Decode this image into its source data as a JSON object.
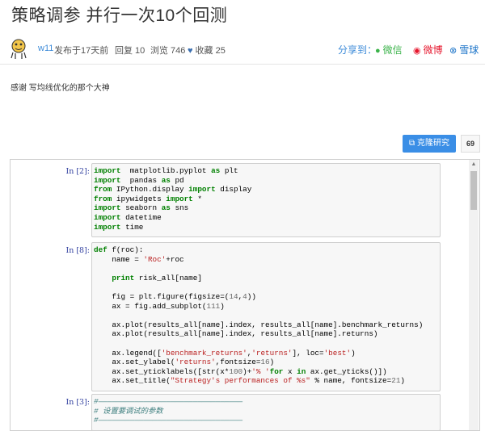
{
  "page": {
    "title": "策略调参 并行一次10个回测"
  },
  "meta": {
    "user": "w11",
    "posted": "发布于17天前",
    "replies": "回复 10",
    "views": "浏览 746",
    "favorites": "收藏 25",
    "heart_icon": "heart-icon"
  },
  "share": {
    "label": "分享到：",
    "wechat": "微信",
    "weibo": "微博",
    "xueqiu": "雪球"
  },
  "post": {
    "body": "感谢 写均线优化的那个大神"
  },
  "actions": {
    "clone_label": "克隆研究",
    "clone_count": "69"
  },
  "notebook": {
    "cells": [
      {
        "prompt": "In [2]:",
        "lines": [
          [
            [
              "kw",
              "import"
            ],
            [
              "",
              "  matplotlib.pyplot "
            ],
            [
              "kw",
              "as"
            ],
            [
              "",
              " plt"
            ]
          ],
          [
            [
              "kw",
              "import"
            ],
            [
              "",
              "  pandas "
            ],
            [
              "kw",
              "as"
            ],
            [
              "",
              " pd"
            ]
          ],
          [
            [
              "kw",
              "from"
            ],
            [
              "",
              " IPython.display "
            ],
            [
              "kw",
              "import"
            ],
            [
              "",
              " display"
            ]
          ],
          [
            [
              "kw",
              "from"
            ],
            [
              "",
              " ipywidgets "
            ],
            [
              "kw",
              "import"
            ],
            [
              "",
              " *"
            ]
          ],
          [
            [
              "kw",
              "import"
            ],
            [
              "",
              " seaborn "
            ],
            [
              "kw",
              "as"
            ],
            [
              "",
              " sns"
            ]
          ],
          [
            [
              "kw",
              "import"
            ],
            [
              "",
              " datetime"
            ]
          ],
          [
            [
              "kw",
              "import"
            ],
            [
              "",
              " time"
            ]
          ]
        ]
      },
      {
        "prompt": "In [8]:",
        "lines": [
          [
            [
              "kw",
              "def"
            ],
            [
              "",
              " f(roc):"
            ]
          ],
          [
            [
              "",
              "    name = "
            ],
            [
              "str",
              "'Roc'"
            ],
            [
              "",
              "+roc"
            ]
          ],
          [
            [
              "",
              ""
            ]
          ],
          [
            [
              "kw",
              "    print"
            ],
            [
              "",
              " risk_all[name]"
            ]
          ],
          [
            [
              "",
              ""
            ]
          ],
          [
            [
              "",
              "    fig = plt.figure(figsize=("
            ],
            [
              "num",
              "14"
            ],
            [
              "",
              ","
            ],
            [
              "num",
              "4"
            ],
            [
              "",
              "))"
            ]
          ],
          [
            [
              "",
              "    ax = fig.add_subplot("
            ],
            [
              "num",
              "111"
            ],
            [
              "",
              ")"
            ]
          ],
          [
            [
              "",
              ""
            ]
          ],
          [
            [
              "",
              "    ax.plot(results_all[name].index, results_all[name].benchmark_returns)"
            ]
          ],
          [
            [
              "",
              "    ax.plot(results_all[name].index, results_all[name].returns)"
            ]
          ],
          [
            [
              "",
              ""
            ]
          ],
          [
            [
              "",
              "    ax.legend(["
            ],
            [
              "str",
              "'benchmark_returns'"
            ],
            [
              "",
              ","
            ],
            [
              "str",
              "'returns'"
            ],
            [
              "",
              "], loc="
            ],
            [
              "str",
              "'best'"
            ],
            [
              "",
              ")"
            ]
          ],
          [
            [
              "",
              "    ax.set_ylabel("
            ],
            [
              "str",
              "'returns'"
            ],
            [
              "",
              ",fontsize="
            ],
            [
              "num",
              "16"
            ],
            [
              "",
              ")"
            ]
          ],
          [
            [
              "",
              "    ax.set_yticklabels([str(x*"
            ],
            [
              "num",
              "100"
            ],
            [
              "",
              ")+"
            ],
            [
              "str",
              "'% '"
            ],
            [
              "kw",
              "for"
            ],
            [
              "",
              " x "
            ],
            [
              "kw",
              "in"
            ],
            [
              "",
              " ax.get_yticks()])"
            ]
          ],
          [
            [
              "",
              "    ax.set_title("
            ],
            [
              "str",
              "\"Strategy's performances of %s\""
            ],
            [
              "",
              " % name, fontsize="
            ],
            [
              "num",
              "21"
            ],
            [
              "",
              ")"
            ]
          ]
        ]
      },
      {
        "prompt": "In [3]:",
        "lines": [
          [
            [
              "cm",
              "#————————————————————————————————"
            ]
          ],
          [
            [
              "cm",
              "# 设置要调试的参数"
            ]
          ],
          [
            [
              "cm",
              "#————————————————————————————————"
            ]
          ]
        ]
      }
    ]
  }
}
